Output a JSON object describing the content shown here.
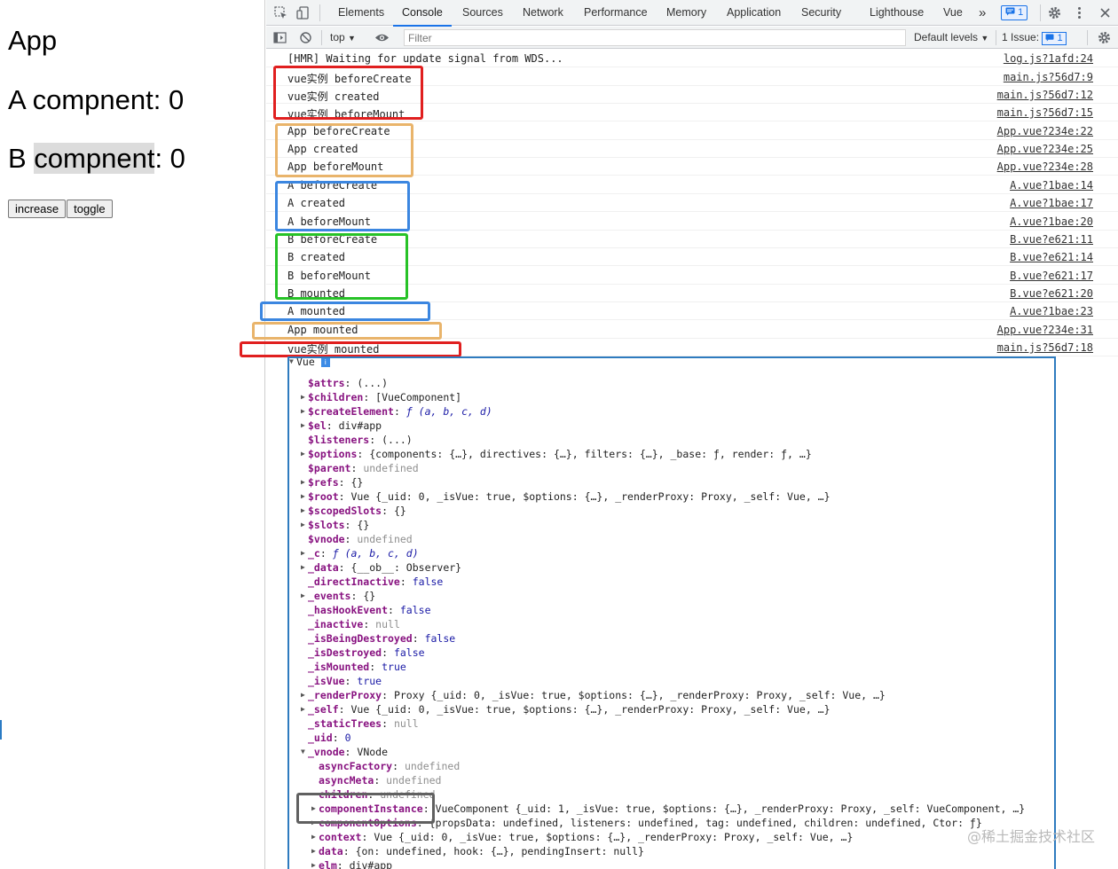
{
  "page": {
    "title": "App",
    "comp_a_prefix": "A compnent: ",
    "comp_a_value": "0",
    "comp_b_prefix": "B ",
    "comp_b_highlight": "compnent",
    "comp_b_suffix": ": 0",
    "increase_label": "increase",
    "toggle_label": "toggle"
  },
  "devtools": {
    "tabs": [
      "Elements",
      "Console",
      "Sources",
      "Network",
      "Performance",
      "Memory",
      "Application",
      "Security",
      "Lighthouse",
      "Vue"
    ],
    "active_tab": "Console",
    "more_tabs": "»",
    "message_badge": "1",
    "toolbar": {
      "context": "top",
      "filter_placeholder": "Filter",
      "levels": "Default levels",
      "issues_prefix": "1 Issue:",
      "issues_count": "1"
    },
    "colors": {
      "accent": "#1a73e8",
      "red": "#e01f1f",
      "orange": "#e9b46b",
      "blue": "#3b86e0",
      "green": "#27c227",
      "gray": "#606060"
    }
  },
  "console": {
    "messages": [
      {
        "text": "[HMR] Waiting for update signal from WDS...",
        "source": "log.js?1afd:24"
      },
      {
        "text": "vue实例 beforeCreate",
        "source": "main.js?56d7:9"
      },
      {
        "text": "vue实例 created",
        "source": "main.js?56d7:12"
      },
      {
        "text": "vue实例 beforeMount",
        "source": "main.js?56d7:15"
      },
      {
        "text": "App beforeCreate",
        "source": "App.vue?234e:22"
      },
      {
        "text": "App created",
        "source": "App.vue?234e:25"
      },
      {
        "text": "App beforeMount",
        "source": "App.vue?234e:28"
      },
      {
        "text": "A beforeCreate",
        "source": "A.vue?1bae:14"
      },
      {
        "text": "A created",
        "source": "A.vue?1bae:17"
      },
      {
        "text": "A beforeMount",
        "source": "A.vue?1bae:20"
      },
      {
        "text": "B beforeCreate",
        "source": "B.vue?e621:11"
      },
      {
        "text": "B created",
        "source": "B.vue?e621:14"
      },
      {
        "text": "B beforeMount",
        "source": "B.vue?e621:17"
      },
      {
        "text": "B mounted",
        "source": "B.vue?e621:20"
      },
      {
        "text": "A mounted",
        "source": "A.vue?1bae:23"
      },
      {
        "text": "App mounted",
        "source": "App.vue?234e:31"
      },
      {
        "text": "vue实例 mounted",
        "source": "main.js?56d7:18"
      }
    ],
    "tree_root": "Vue",
    "info_badge": "i",
    "tree": [
      {
        "key": "$attrs",
        "value": "(...)",
        "style": "plain"
      },
      {
        "key": "$children",
        "value": "[VueComponent]",
        "style": "plain",
        "exp": true
      },
      {
        "key": "$createElement",
        "value": "ƒ (a, b, c, d)",
        "style": "fn",
        "exp": true
      },
      {
        "key": "$el",
        "value": "div#app",
        "style": "plain",
        "exp": true
      },
      {
        "key": "$listeners",
        "value": "(...)",
        "style": "plain"
      },
      {
        "key": "$options",
        "value": "{components: {…}, directives: {…}, filters: {…}, _base: ƒ, render: ƒ, …}",
        "style": "plain",
        "exp": true
      },
      {
        "key": "$parent",
        "value": "undefined",
        "style": "dim"
      },
      {
        "key": "$refs",
        "value": "{}",
        "style": "plain",
        "exp": true
      },
      {
        "key": "$root",
        "value": "Vue {_uid: 0, _isVue: true, $options: {…}, _renderProxy: Proxy, _self: Vue, …}",
        "style": "plain",
        "exp": true
      },
      {
        "key": "$scopedSlots",
        "value": "{}",
        "style": "plain",
        "exp": true
      },
      {
        "key": "$slots",
        "value": "{}",
        "style": "plain",
        "exp": true
      },
      {
        "key": "$vnode",
        "value": "undefined",
        "style": "dim"
      },
      {
        "key": "_c",
        "value": "ƒ (a, b, c, d)",
        "style": "fn",
        "exp": true
      },
      {
        "key": "_data",
        "value": "{__ob__: Observer}",
        "style": "plain",
        "exp": true
      },
      {
        "key": "_directInactive",
        "value": "false",
        "style": "bool"
      },
      {
        "key": "_events",
        "value": "{}",
        "style": "plain",
        "exp": true
      },
      {
        "key": "_hasHookEvent",
        "value": "false",
        "style": "bool"
      },
      {
        "key": "_inactive",
        "value": "null",
        "style": "dim"
      },
      {
        "key": "_isBeingDestroyed",
        "value": "false",
        "style": "bool"
      },
      {
        "key": "_isDestroyed",
        "value": "false",
        "style": "bool"
      },
      {
        "key": "_isMounted",
        "value": "true",
        "style": "bool"
      },
      {
        "key": "_isVue",
        "value": "true",
        "style": "bool"
      },
      {
        "key": "_renderProxy",
        "value": "Proxy {_uid: 0, _isVue: true, $options: {…}, _renderProxy: Proxy, _self: Vue, …}",
        "style": "plain",
        "exp": true
      },
      {
        "key": "_self",
        "value": "Vue {_uid: 0, _isVue: true, $options: {…}, _renderProxy: Proxy, _self: Vue, …}",
        "style": "plain",
        "exp": true
      },
      {
        "key": "_staticTrees",
        "value": "null",
        "style": "dim"
      },
      {
        "key": "_uid",
        "value": "0",
        "style": "bool"
      },
      {
        "key": "_vnode",
        "value": "VNode",
        "style": "plain",
        "exp": true,
        "open": true
      },
      {
        "key": "asyncFactory",
        "value": "undefined",
        "style": "dim",
        "lvl": 2
      },
      {
        "key": "asyncMeta",
        "value": "undefined",
        "style": "dim",
        "lvl": 2
      },
      {
        "key": "children",
        "value": "undefined",
        "style": "dim",
        "lvl": 2
      },
      {
        "key": "componentInstance",
        "value": "VueComponent {_uid: 1, _isVue: true, $options: {…}, _renderProxy: Proxy, _self: VueComponent, …}",
        "style": "plain",
        "exp": true,
        "lvl": 2
      },
      {
        "key": "componentOptions",
        "value": "{propsData: undefined, listeners: undefined, tag: undefined, children: undefined, Ctor: ƒ}",
        "style": "plain",
        "exp": true,
        "lvl": 2
      },
      {
        "key": "context",
        "value": "Vue {_uid: 0, _isVue: true, $options: {…}, _renderProxy: Proxy, _self: Vue, …}",
        "style": "plain",
        "exp": true,
        "lvl": 2
      },
      {
        "key": "data",
        "value": "{on: undefined, hook: {…}, pendingInsert: null}",
        "style": "plain",
        "exp": true,
        "lvl": 2
      },
      {
        "key": "elm",
        "value": "div#app",
        "style": "plain",
        "exp": true,
        "lvl": 2
      }
    ]
  },
  "watermark": "@稀土掘金技术社区"
}
